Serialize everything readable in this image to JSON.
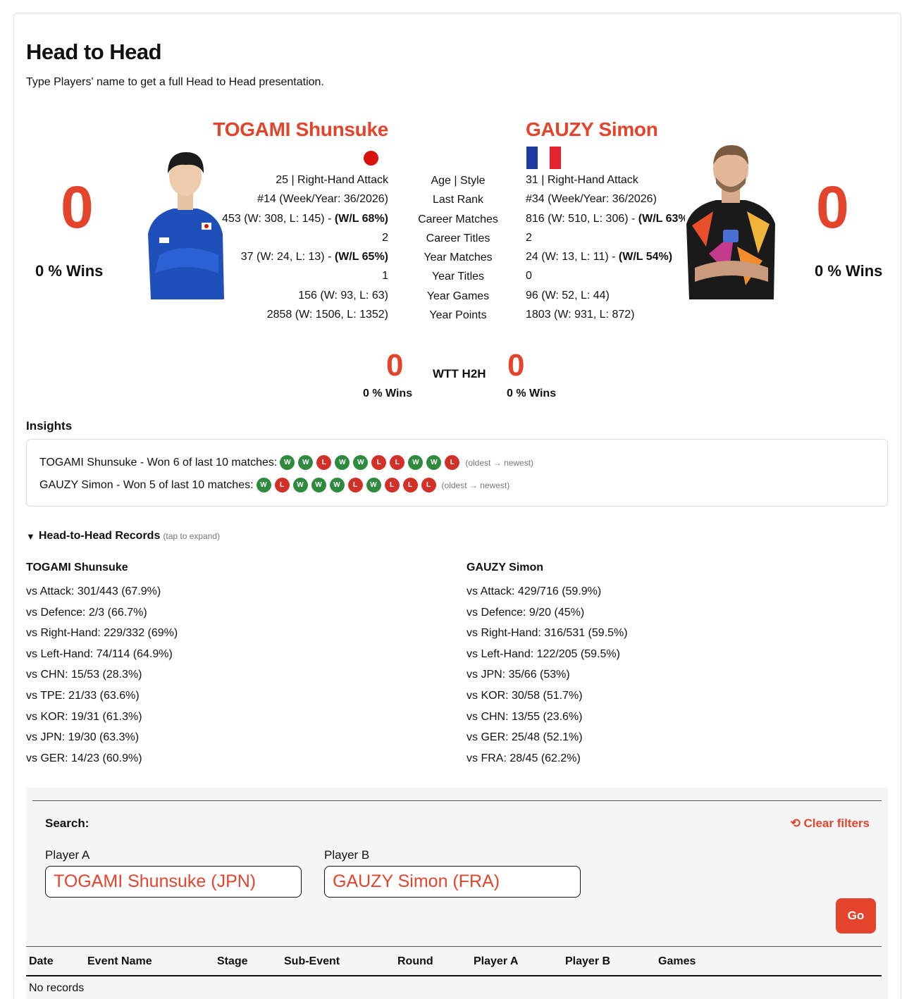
{
  "header": {
    "title": "Head to Head",
    "subtitle": "Type Players' name to get a full Head to Head presentation."
  },
  "player_a": {
    "name": "TOGAMI Shunsuke",
    "score": "0",
    "wins_label": "0 % Wins",
    "flag_icon": "japan-flag-icon",
    "stats": {
      "age_style": "25 | Right-Hand Attack",
      "last_rank": "#14 (Week/Year: 36/2026)",
      "career_matches": "453 (W: 308, L: 145) - ",
      "career_matches_wl": "(W/L 68%)",
      "career_titles": "2",
      "year_matches": "37 (W: 24, L: 13) - ",
      "year_matches_wl": "(W/L 65%)",
      "year_titles": "1",
      "year_games": "156 (W: 93, L: 63)",
      "year_points": "2858 (W: 1506, L: 1352)"
    }
  },
  "player_b": {
    "name": "GAUZY Simon",
    "score": "0",
    "wins_label": "0 % Wins",
    "flag_icon": "france-flag-icon",
    "stats": {
      "age_style": "31 | Right-Hand Attack",
      "last_rank": "#34 (Week/Year: 36/2026)",
      "career_matches": "816 (W: 510, L: 306) - ",
      "career_matches_wl": "(W/L 63%)",
      "career_titles": "2",
      "year_matches": "24 (W: 13, L: 11) - ",
      "year_matches_wl": "(W/L 54%)",
      "year_titles": "0",
      "year_games": "96 (W: 52, L: 44)",
      "year_points": "1803 (W: 931, L: 872)"
    }
  },
  "stat_labels": {
    "age_style": "Age | Style",
    "last_rank": "Last Rank",
    "career_matches": "Career Matches",
    "career_titles": "Career Titles",
    "year_matches": "Year Matches",
    "year_titles": "Year Titles",
    "year_games": "Year Games",
    "year_points": "Year Points"
  },
  "wtt": {
    "label": "WTT H2H",
    "a_score": "0",
    "a_wins": "0 % Wins",
    "b_score": "0",
    "b_wins": "0 % Wins"
  },
  "insights": {
    "title": "Insights",
    "a_text": "TOGAMI Shunsuke - Won 6 of last 10 matches:",
    "a_form": [
      "W",
      "W",
      "L",
      "W",
      "W",
      "L",
      "L",
      "W",
      "W",
      "L"
    ],
    "b_text": "GAUZY Simon - Won 5 of last 10 matches:",
    "b_form": [
      "W",
      "L",
      "W",
      "W",
      "W",
      "L",
      "W",
      "L",
      "L",
      "L"
    ],
    "order_note": "(oldest → newest)"
  },
  "records": {
    "toggle_label": "Head-to-Head Records",
    "toggle_hint": "(tap to expand)",
    "a_name": "TOGAMI Shunsuke",
    "a_items": [
      "vs Attack: 301/443 (67.9%)",
      "vs Defence: 2/3 (66.7%)",
      "vs Right-Hand: 229/332 (69%)",
      "vs Left-Hand: 74/114 (64.9%)",
      "vs CHN: 15/53 (28.3%)",
      "vs TPE: 21/33 (63.6%)",
      "vs KOR: 19/31 (61.3%)",
      "vs JPN: 19/30 (63.3%)",
      "vs GER: 14/23 (60.9%)"
    ],
    "b_name": "GAUZY Simon",
    "b_items": [
      "vs Attack: 429/716 (59.9%)",
      "vs Defence: 9/20 (45%)",
      "vs Right-Hand: 316/531 (59.5%)",
      "vs Left-Hand: 122/205 (59.5%)",
      "vs JPN: 35/66 (53%)",
      "vs KOR: 30/58 (51.7%)",
      "vs CHN: 13/55 (23.6%)",
      "vs GER: 25/48 (52.1%)",
      "vs FRA: 28/45 (62.2%)"
    ]
  },
  "search": {
    "label": "Search:",
    "clear_filters": "Clear filters",
    "player_a_label": "Player A",
    "player_a_value": "TOGAMI Shunsuke (JPN)",
    "player_b_label": "Player B",
    "player_b_value": "GAUZY Simon (FRA)",
    "go_label": "Go"
  },
  "table": {
    "columns": [
      "Date",
      "Event Name",
      "Stage",
      "Sub-Event",
      "Round",
      "Player A",
      "Player B",
      "Games"
    ],
    "empty_text": "No records"
  },
  "colors": {
    "accent": "#e3442b",
    "win": "#2e8b3e",
    "loss": "#d2312a"
  }
}
